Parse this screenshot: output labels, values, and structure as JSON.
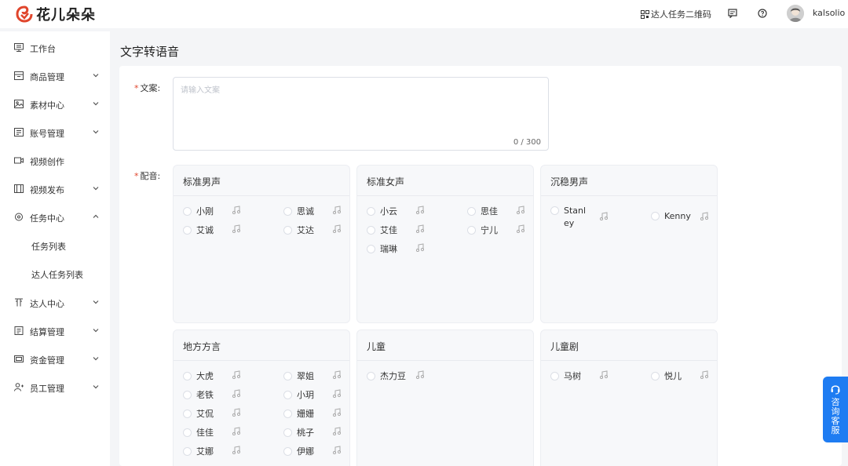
{
  "header": {
    "logo_text": "花儿朵朵",
    "qr_label": "达人任务二维码",
    "username": "kalsolio"
  },
  "sidebar": {
    "items": [
      {
        "label": "工作台",
        "icon": "monitor-icon",
        "expandable": false
      },
      {
        "label": "商品管理",
        "icon": "box-icon",
        "expandable": true,
        "expanded": false
      },
      {
        "label": "素材中心",
        "icon": "image-icon",
        "expandable": true,
        "expanded": false
      },
      {
        "label": "账号管理",
        "icon": "id-card-icon",
        "expandable": true,
        "expanded": false
      },
      {
        "label": "视频创作",
        "icon": "video-icon",
        "expandable": false
      },
      {
        "label": "视频发布",
        "icon": "publish-icon",
        "expandable": true,
        "expanded": false
      },
      {
        "label": "任务中心",
        "icon": "task-icon",
        "expandable": true,
        "expanded": true
      },
      {
        "label": "任务列表",
        "sub": true
      },
      {
        "label": "达人任务列表",
        "sub": true
      },
      {
        "label": "达人中心",
        "icon": "influencer-icon",
        "expandable": true,
        "expanded": false
      },
      {
        "label": "结算管理",
        "icon": "settlement-icon",
        "expandable": true,
        "expanded": false
      },
      {
        "label": "资金管理",
        "icon": "wallet-icon",
        "expandable": true,
        "expanded": false
      },
      {
        "label": "员工管理",
        "icon": "add-user-icon",
        "expandable": true,
        "expanded": false
      }
    ]
  },
  "page": {
    "title": "文字转语音"
  },
  "form": {
    "copy_label": "文案:",
    "copy_placeholder": "请输入文案",
    "copy_counter": "0 / 300",
    "voice_label": "配音:",
    "required_mark": "*"
  },
  "voice_groups": [
    {
      "title": "标准男声",
      "voices": [
        "小刚",
        "思诚",
        "艾诚",
        "艾达"
      ]
    },
    {
      "title": "标准女声",
      "voices": [
        "小云",
        "思佳",
        "艾佳",
        "宁儿",
        "瑞琳"
      ]
    },
    {
      "title": "沉稳男声",
      "voices": [
        "Stanley",
        "Kenny"
      ]
    },
    {
      "title": "地方方言",
      "voices": [
        "大虎",
        "翠姐",
        "老铁",
        "小玥",
        "艾侃",
        "姗姗",
        "佳佳",
        "桃子",
        "艾娜",
        "伊娜"
      ]
    },
    {
      "title": "儿童",
      "voices": [
        "杰力豆"
      ]
    },
    {
      "title": "儿童剧",
      "voices": [
        "马树",
        "悦儿"
      ]
    }
  ],
  "consult_button": {
    "label": "咨询客服"
  },
  "colors": {
    "brand_red": "#e0452c",
    "accent_blue": "#1e7cf2"
  }
}
